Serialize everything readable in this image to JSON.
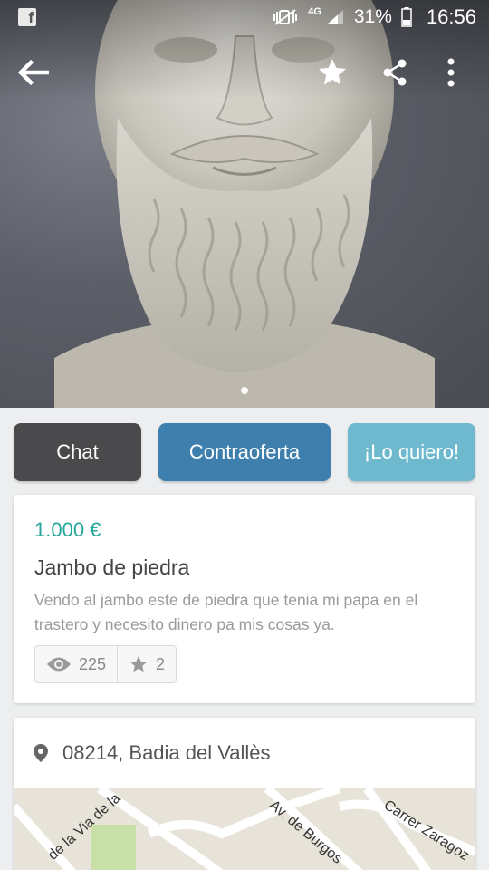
{
  "status_bar": {
    "app_icon": "facebook-icon",
    "network": "4G",
    "battery": "31%",
    "time": "16:56"
  },
  "toolbar": {
    "back_icon": "arrow-left-icon",
    "favorite_icon": "star-icon",
    "share_icon": "share-icon",
    "more_icon": "more-vertical-icon"
  },
  "gallery": {
    "image_subject": "marble bust",
    "page_count": 1,
    "current_page": 1
  },
  "actions": {
    "chat": "Chat",
    "counteroffer": "Contraoferta",
    "want": "¡Lo quiero!"
  },
  "product": {
    "price": "1.000 €",
    "title": "Jambo de piedra",
    "description": "Vendo al jambo este de piedra que tenia mi papa en el trastero y necesito dinero pa mis cosas ya.",
    "views": "225",
    "favorites": "2"
  },
  "location": {
    "address": "08214, Badia del Vallès",
    "map_labels": {
      "street1": "de la Via de la",
      "street2": "Av. de Burgos",
      "street3": "Carrer Zaragoz"
    }
  },
  "colors": {
    "chat_button": "#4a4a4c",
    "counteroffer_button": "#3f7fae",
    "want_button": "#6fb9cf",
    "price": "#26a69a"
  }
}
